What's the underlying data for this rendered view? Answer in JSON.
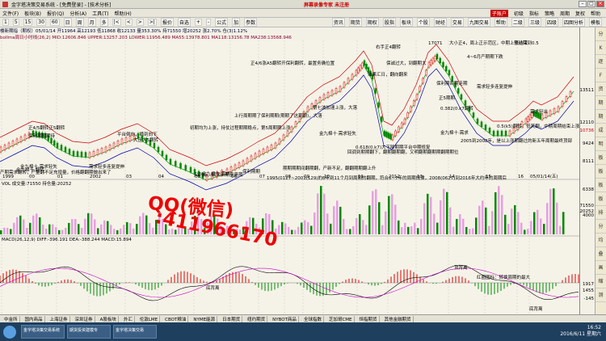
{
  "window": {
    "title": "金字塔决策交易系统 - [免费登录] - [技术分析]",
    "banner": "屏幕录像专家 未注册"
  },
  "menu": {
    "items": [
      "文件(F)",
      "板块(B)",
      "报价(Q)",
      "分析(A)",
      "工具(T)",
      "帮助(H)"
    ],
    "right_items": [
      "子账户",
      "初级",
      "指标",
      "策略",
      "周期",
      "复权",
      "帮助"
    ]
  },
  "toolbar": {
    "items": [
      "1",
      "5",
      "15",
      "30",
      "60",
      "日",
      "周",
      "月",
      "多",
      "|<",
      "<",
      ">",
      ">|",
      "报价",
      "自选",
      "+",
      "-",
      "公式",
      "加",
      "参数"
    ],
    "right_items": [
      "资讯",
      "期货",
      "期权",
      "股指",
      "板块",
      "个股",
      "财经",
      "交易",
      "九图交易",
      "帮助",
      "二级",
      "三级",
      "四级",
      "四图分析",
      "模板"
    ]
  },
  "info": {
    "line1": "楼新期指（期权）05/01/14 开11964 高12193 低11868 收12133 量353.30% 持71550 增20252 涨2.70% 仓(3)1.12%",
    "line2": "bollma周日小时线(26,2) MID:12606.846 UPPER:13257.203 LOWER:11956.489 MA55:13978.801 MA118:13156.78 MA238:13568.946"
  },
  "price_scale": [
    "13511",
    "12110",
    "10736",
    "9424",
    "8111",
    "6338",
    "4000"
  ],
  "vol_scale": [
    "71550",
    "20252"
  ],
  "macd_scale": [
    "1917",
    "1455",
    "-145"
  ],
  "year_axis": [
    "1999",
    "00",
    "01",
    "2002",
    "03",
    "04",
    "05",
    "06",
    "07",
    "08",
    "09",
    "10",
    "11",
    "2012",
    "13",
    "14",
    "15",
    "16",
    "05/01/14(五)"
  ],
  "panels": {
    "vol_label": "VOL 成交量:71550 持仓量:20252",
    "macd_label": "MACD(26,12,9) DIFF:-396.191 DEA:-388.244 MACD:15.894"
  },
  "annotations": [
    {
      "text": "正4/5翻转正5翻转"
    },
    {
      "text": "金九棉十·翻转"
    },
    {
      "text": "保利期期期待"
    },
    {
      "text": "金九棉十·需求轻失"
    },
    {
      "text": "需求轻多连复提伸"
    },
    {
      "text": "平台倒向，摘到向下"
    },
    {
      "text": "大正大5翻转"
    },
    {
      "text": "金九棉十·需求"
    },
    {
      "text": "保利期期"
    },
    {
      "text": "初期均为上涨，持仗过程期期稳点，第5周期期上涨"
    },
    {
      "text": "上行周期期了保利期期(期期了这期期)，大落"
    },
    {
      "text": "正4/6涨A5翻转开保利翻转，最置务确位置"
    },
    {
      "text": "金九棉十·需求轻失"
    },
    {
      "text": "第七波加速上涨，大落"
    },
    {
      "text": "右手正4翻转"
    },
    {
      "text": "保诚过大，到翻期大"
    },
    {
      "text": "效果汇日，翻向翻来"
    },
    {
      "text": "17071"
    },
    {
      "text": "大小正4，周上正示范区，中期上涨结束"
    },
    {
      "text": "4~6月产期期下跌"
    },
    {
      "text": "保利期间期走期"
    },
    {
      "text": "正5期期"
    },
    {
      "text": "0.382(0.k7翻转"
    },
    {
      "text": "金九棉十·需求"
    },
    {
      "text": "需求轻多连复提伸"
    },
    {
      "text": "预计回到0.5"
    },
    {
      "text": "需求轻出"
    },
    {
      "text": "0.618(0.k7)大下降期期平台中期修复"
    },
    {
      "text": "回调到期期翻下，翻期翻期翻，又明翻期翻期期翻期期位"
    },
    {
      "text": "0.5(k5)翻转，低笑翻，中期周期结束上涨"
    },
    {
      "text": "2005到2008年，是以上涨期翻过的新五年周期最终顶部"
    },
    {
      "text": "1995(0127~2001(129)的6年到11个月到周期的翻期，符合6~7年的周期规律，2008(0627)到2016年大约年的周期后"
    },
    {
      "text": "期期期期间翻期翻，产新不足，翻翻期期翻上升"
    },
    {
      "text": "尖刺点，底笑汇期量量期"
    },
    {
      "text": "产期需求翻转，产量翻不足充增量，价格翻翻期做出来了"
    },
    {
      "text": "底背离"
    },
    {
      "text": "顶背离"
    },
    {
      "text": "红圈图标：转换周期的最大"
    },
    {
      "text": "底背离"
    }
  ],
  "watermark": {
    "line1": "QQ(微信)",
    "line2": ":411966170"
  },
  "tabs": [
    "中金所",
    "国内商品",
    "上海证券",
    "深圳证券",
    "A股板块",
    "外汇",
    "伦敦LME",
    "CBOT粮油",
    "NYME能源",
    "日本期货",
    "纽约期货",
    "NYBOT商品",
    "全球指数",
    "芝加哥CME",
    "恒指期货",
    "其他金融期货"
  ],
  "taskbar": {
    "tasks": [
      "金字塔决策交易系统",
      "期货投资建模专",
      "金字塔决策交易"
    ],
    "time": "16:52",
    "date": "2016/6/11 星期六"
  },
  "right_icons": [
    "分时",
    "K线",
    "逐笔",
    "F10",
    "资讯",
    "期权",
    "期货",
    "成交",
    "明细",
    "板块",
    "板块",
    "板块",
    "板块",
    "排行",
    "分时",
    "均线",
    "叠加",
    "画线",
    "缩放",
    "测量"
  ]
}
